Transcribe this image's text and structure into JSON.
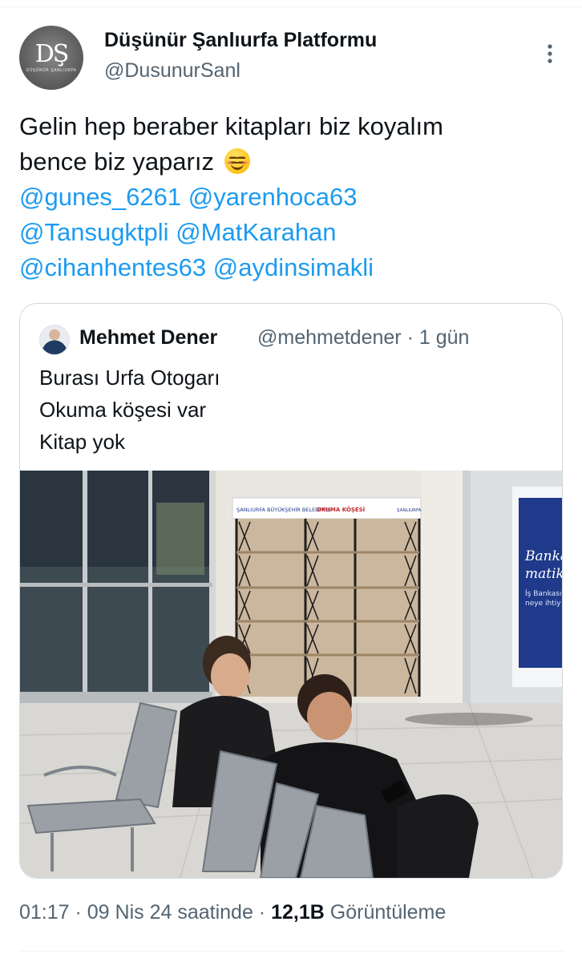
{
  "author": {
    "name": "Düşünür Şanlıurfa Platformu",
    "handle": "@DusunurSanl",
    "avatar_monogram": "DŞ",
    "avatar_caption": "DÜŞÜNÜR ŞANLIURFA"
  },
  "tweet": {
    "line1": "Gelin hep beraber kitapları biz koyalım",
    "line2": "bence biz yaparız",
    "emoji": "smiling-face-with-smiling-eyes",
    "mentions": [
      "@gunes_6261",
      "@yarenhoca63",
      "@Tansugktpli",
      "@MatKarahan",
      "@cihanhentes63",
      "@aydinsimakli"
    ]
  },
  "quoted": {
    "name": "Mehmet Dener",
    "handle_time": "@mehmetdener · 1 gün",
    "lines": [
      "Burası Urfa Otogarı",
      "Okuma köşesi var",
      "Kitap yok"
    ],
    "photo": {
      "sign_left": "ŞANLIURFA BÜYÜKŞEHİR BELEDİYESİ",
      "sign_middle": "OKUMA KÖŞESİ",
      "sign_right": "ŞANLIURFA",
      "banner_line1": "Banka",
      "banner_line2": "matik",
      "banner_line3": "İş Bankası",
      "banner_line4": "neye ihtiy"
    }
  },
  "meta": {
    "time_date": "01:17 · 09 Nis 24 saatinde ·",
    "views": "12,1B",
    "views_label": "Görüntüleme"
  },
  "colors": {
    "link": "#1d9bf0",
    "text": "#0f1419",
    "secondary": "#536471",
    "border": "#cfd9de"
  }
}
